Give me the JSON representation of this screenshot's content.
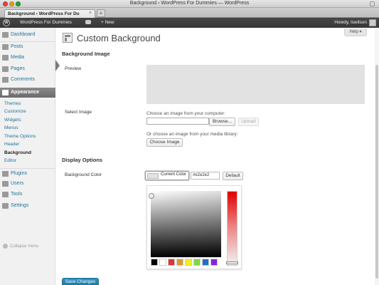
{
  "window": {
    "title": "Background ‹ WordPress For Dummies — WordPress"
  },
  "tab": {
    "title": "Background ‹ WordPress For Du",
    "close": "×",
    "new": "+"
  },
  "adminbar": {
    "logo": "W",
    "site_name": "WordPress For Dummies",
    "new_label": "+ New",
    "howdy": "Howdy, lswilson"
  },
  "sidebar": {
    "items": [
      {
        "label": "Dashboard",
        "icon": "dashboard-icon"
      },
      {
        "label": "Posts",
        "icon": "pin-icon"
      },
      {
        "label": "Media",
        "icon": "media-icon"
      },
      {
        "label": "Pages",
        "icon": "page-icon"
      },
      {
        "label": "Comments",
        "icon": "comment-icon"
      },
      {
        "label": "Appearance",
        "icon": "appearance-icon"
      },
      {
        "label": "Plugins",
        "icon": "plug-icon"
      },
      {
        "label": "Users",
        "icon": "users-icon"
      },
      {
        "label": "Tools",
        "icon": "tools-icon"
      },
      {
        "label": "Settings",
        "icon": "settings-icon"
      }
    ],
    "submenu": [
      "Themes",
      "Customize",
      "Widgets",
      "Menus",
      "Theme Options",
      "Header",
      "Background",
      "Editor"
    ],
    "collapse": "Collapse menu"
  },
  "help": "Help ▾",
  "page": {
    "title": "Custom Background",
    "section_image": "Background Image",
    "preview_label": "Preview",
    "select_label": "Select Image",
    "hint_computer": "Choose an image from your computer:",
    "browse": "Browse...",
    "upload": "Upload",
    "hint_library": "Or choose an image from your media library:",
    "choose_image": "Choose Image",
    "section_display": "Display Options",
    "bg_color_label": "Background Color",
    "current_color": "Current Color",
    "hex_value": "#e2e2e2",
    "default": "Default",
    "save": "Save Changes"
  },
  "colors": {
    "accent": "#21759b",
    "current_bg": "#e2e2e2",
    "palette": [
      "#000000",
      "#ffffff",
      "#dd3333",
      "#dd9933",
      "#eeee22",
      "#81d742",
      "#1e73be",
      "#8224e3"
    ]
  }
}
